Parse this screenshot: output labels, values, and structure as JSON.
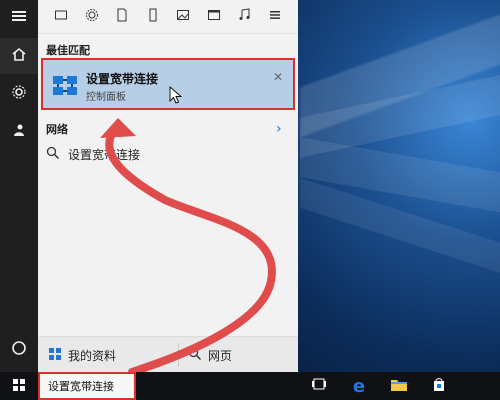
{
  "colors": {
    "accent_blue": "#1e78d7",
    "highlight_row": "#b7cfe6",
    "annotation_red": "#d8322f"
  },
  "start_menu": {
    "sections": {
      "best_match": "最佳匹配",
      "network": "网络"
    },
    "best_match": {
      "title": "设置宽带连接",
      "subtitle": "控制面板"
    },
    "network_item": "设置宽带连接",
    "bottom": {
      "my_stuff": "我的资料",
      "web": "网页"
    }
  },
  "taskbar": {
    "search_text": "设置宽带连接"
  },
  "icons": {
    "left_strip": [
      "hamburger-icon",
      "home-icon",
      "settings-icon",
      "feedback-icon",
      "power-icon"
    ],
    "topbar": [
      "tablet-icon",
      "settings-icon",
      "document-icon",
      "phone-icon",
      "image-icon",
      "window-icon",
      "music-icon",
      "menu-icon"
    ],
    "best_match_app": "network-connections-icon",
    "network_row": "search-icon",
    "bottom": [
      "windows-logo-icon",
      "search-icon"
    ],
    "taskbar": [
      "start-windows-logo-icon",
      "task-view-icon",
      "edge-icon",
      "file-explorer-icon",
      "store-icon"
    ]
  }
}
